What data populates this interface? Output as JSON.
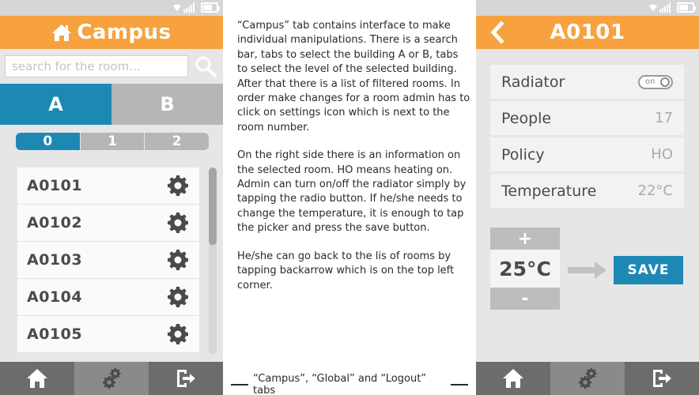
{
  "left_phone": {
    "title": "Campus",
    "search": {
      "placeholder": "search for the room..."
    },
    "building_tabs": [
      {
        "label": "A",
        "active": true
      },
      {
        "label": "B",
        "active": false
      }
    ],
    "level_tabs": [
      {
        "label": "0",
        "active": true
      },
      {
        "label": "1",
        "active": false
      },
      {
        "label": "2",
        "active": false
      }
    ],
    "rooms": [
      "A0101",
      "A0102",
      "A0103",
      "A0104",
      "A0105"
    ],
    "bottom_nav": {
      "active": "campus"
    }
  },
  "right_phone": {
    "title": "A0101",
    "details": [
      {
        "label": "Radiator",
        "toggle": "on"
      },
      {
        "label": "People",
        "value": "17"
      },
      {
        "label": "Policy",
        "value": "HO"
      },
      {
        "label": "Temperature",
        "value": "22°C"
      }
    ],
    "picker": {
      "plus": "+",
      "value": "25°C",
      "minus": "-"
    },
    "save_label": "SAVE",
    "bottom_nav": {
      "active": "global"
    }
  },
  "description": {
    "paragraphs": [
      "“Campus” tab contains interface to make individual manipulations. There is a search bar, tabs to select the building A or B, tabs to select the level of the selected building. After that there is a list of filtered rooms. In order make changes for a room admin has to click on settings icon which is next to the room number.",
      "On the right side there is an information on the selected room. HO means heating on. Admin can turn on/off the radiator simply by tapping the radio button. If he/she needs to change the temperature, it is enough to tap the picker and press the save button.",
      "He/she can go back to the lis of rooms by tapping backarrow which is on the top left corner."
    ],
    "caption": "“Campus”, “Global” and “Logout” tabs"
  },
  "colors": {
    "accent_orange": "#f7a23e",
    "accent_blue": "#1e88b4",
    "nav_gray": "#6c6c6c"
  }
}
